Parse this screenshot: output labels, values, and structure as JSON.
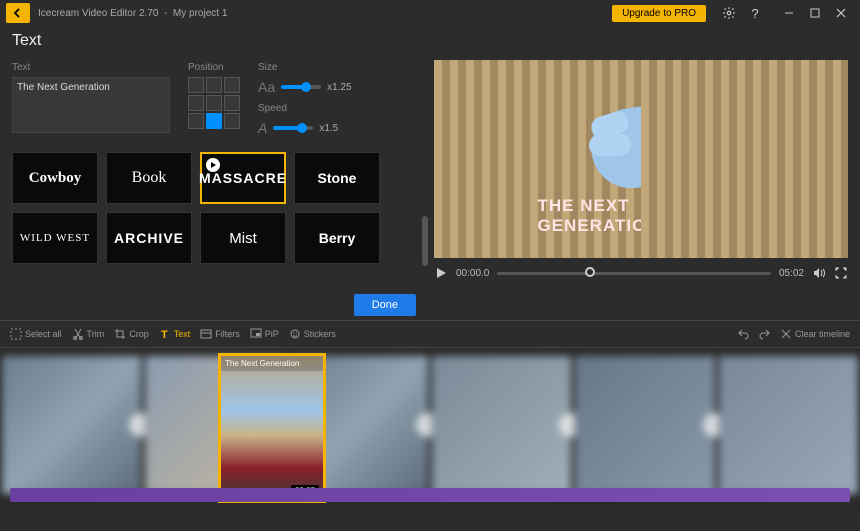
{
  "titlebar": {
    "app": "Icecream Video Editor 2.70",
    "sep": "-",
    "project": "My project 1",
    "upgrade": "Upgrade to PRO"
  },
  "panel": {
    "title": "Text"
  },
  "textEdit": {
    "label": "Text",
    "value": "The Next Generation",
    "positionLabel": "Position",
    "activeCell": 7,
    "sizeLabel": "Size",
    "sizeValue": "x1.25",
    "sizePercent": 60,
    "speedLabel": "Speed",
    "speedValue": "x1.5",
    "speedPercent": 70,
    "done": "Done"
  },
  "styles": [
    {
      "name": "Cowboy",
      "cls": "f-cowboy"
    },
    {
      "name": "Book",
      "cls": "f-book"
    },
    {
      "name": "MASSACRE",
      "cls": "f-massacre",
      "selected": true
    },
    {
      "name": "Stone",
      "cls": "f-stone"
    },
    {
      "name": "WILD WEST",
      "cls": "f-wildwest"
    },
    {
      "name": "ARCHIVE",
      "cls": "f-archive"
    },
    {
      "name": "Mist",
      "cls": "f-mist"
    },
    {
      "name": "Berry",
      "cls": "f-berry"
    }
  ],
  "preview": {
    "overlay": "THE NEXT GENERATION",
    "currentTime": "00:00.0",
    "totalTime": "05:02"
  },
  "toolbar": {
    "items": [
      {
        "label": "Select all",
        "icon": "select-icon"
      },
      {
        "label": "Trim",
        "icon": "trim-icon"
      },
      {
        "label": "Crop",
        "icon": "crop-icon"
      },
      {
        "label": "Text",
        "icon": "text-icon",
        "active": true
      },
      {
        "label": "Filters",
        "icon": "filters-icon"
      },
      {
        "label": "PiP",
        "icon": "pip-icon"
      },
      {
        "label": "Stickers",
        "icon": "stickers-icon"
      }
    ],
    "clear": "Clear timeline"
  },
  "timeline": {
    "selectedLabel": "The Next Generation",
    "selectedDuration": "00:03"
  },
  "seekPercent": 32
}
